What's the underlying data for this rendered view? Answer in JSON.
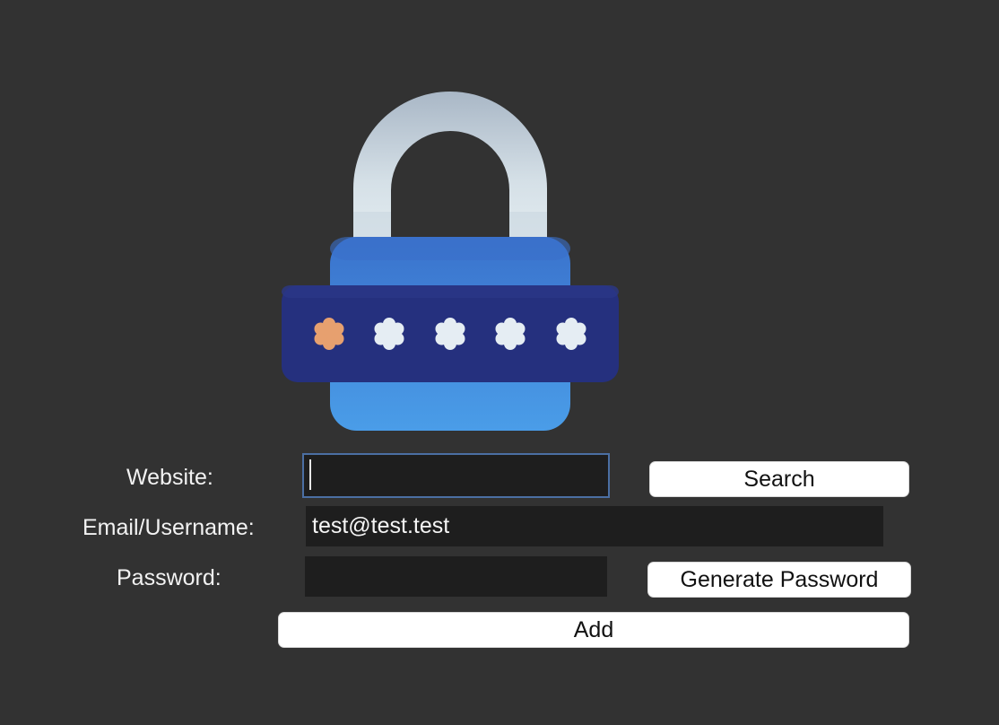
{
  "logo": {
    "icon": "padlock-password-icon",
    "colors": {
      "shackle": "#c4d2dc",
      "body": "#3a7fd5",
      "band": "#24317f",
      "first_asterisk": "#e8a070",
      "asterisks": "#e6eef4"
    }
  },
  "form": {
    "website_label": "Website:",
    "website_value": "",
    "email_label": "Email/Username:",
    "email_value": "test@test.test",
    "password_label": "Password:",
    "password_value": ""
  },
  "buttons": {
    "search": "Search",
    "generate_password": "Generate Password",
    "add": "Add"
  },
  "colors": {
    "background": "#323232",
    "field_background": "#1e1e1e",
    "focus_border": "#4b6fa3",
    "button_background": "#ffffff"
  }
}
